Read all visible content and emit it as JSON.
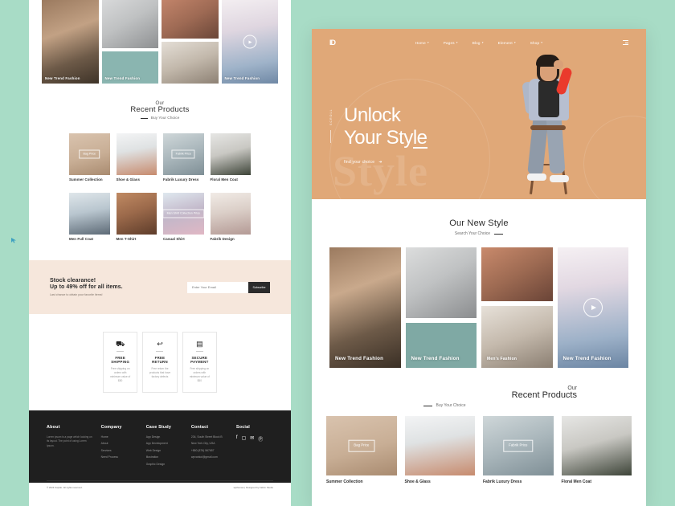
{
  "canvas": {
    "background_color": "#a8dcc6"
  },
  "left_mockup": {
    "hero_tiles": [
      {
        "caption": "New Trend Fashion"
      },
      {
        "caption": ""
      },
      {
        "caption": "New Trend Fashion"
      },
      {
        "caption": ""
      },
      {
        "caption": ""
      },
      {
        "caption": "New Trend Fashion"
      }
    ],
    "recent_products": {
      "eyebrow": "Our",
      "title": "Recent Products",
      "subtitle": "Buy Your Choice"
    },
    "products_row1": [
      {
        "name": "Summer Collection",
        "tag": "Bag Price"
      },
      {
        "name": "Shoe & Glass",
        "tag": ""
      },
      {
        "name": "Fabrik Luxury Dress",
        "tag": "Fabrik Price"
      },
      {
        "name": "Floral Men Coat",
        "tag": ""
      }
    ],
    "products_row2": [
      {
        "name": "Men Full Coat",
        "tag": ""
      },
      {
        "name": "Men T-Shirt",
        "tag": ""
      },
      {
        "name": "Casual Shirt",
        "tag": "Men Shirt Collection Price"
      },
      {
        "name": "Fabrik Design",
        "tag": ""
      }
    ],
    "clearance": {
      "line1": "Stock clearance!",
      "line2": "Up to 49% off for all items.",
      "note": "Last chance to obtain your favorite items!",
      "email_placeholder": "Enter Your Email",
      "subscribe_label": "Subscribe"
    },
    "features": [
      {
        "icon": "truck-icon",
        "glyph": "⛟",
        "title": "FREE SHIPPING",
        "text": "Free shipping on orders with minimum value of $50"
      },
      {
        "icon": "return-arrow-icon",
        "glyph": "↩",
        "title": "FREE RETURN",
        "text": "Free return the products that have factory defects"
      },
      {
        "icon": "card-icon",
        "glyph": "▤",
        "title": "SECURE PAYMENT",
        "text": "Free shipping on orders with minimum value of $50"
      }
    ],
    "footer": {
      "about": {
        "heading": "About",
        "text": "Lorem ipsum is a page which looking on its layout. The point of using Lorem Ipsum."
      },
      "company": {
        "heading": "Company",
        "links": [
          "Home",
          "About",
          "Services",
          "Need Process"
        ]
      },
      "case_study": {
        "heading": "Case Study",
        "links": [
          "App Design",
          "App Development",
          "Web Design",
          "Illustration",
          "Graphic Design"
        ]
      },
      "contact": {
        "heading": "Contact",
        "lines": [
          "234, South Street Block B",
          "New York City, USA",
          "+880 (876) 567657",
          "wpvankol@gmail.com"
        ]
      },
      "social": {
        "heading": "Social",
        "icons": [
          "facebook-icon",
          "instagram-icon",
          "twitter-icon",
          "pinterest-icon"
        ],
        "glyphs": [
          "f",
          "▢",
          "✉",
          "Ⓟ"
        ]
      },
      "copyright": "© 2024 Kapido. All rights reserved.",
      "credit": "wpthemes | Designed by Fahim Studio"
    }
  },
  "right_mockup": {
    "nav": {
      "logo": "ID",
      "items": [
        {
          "label": "Home",
          "has_dropdown": true
        },
        {
          "label": "Pages",
          "has_dropdown": true
        },
        {
          "label": "Blog",
          "has_dropdown": true
        },
        {
          "label": "Element",
          "has_dropdown": true
        },
        {
          "label": "Shop",
          "has_dropdown": true
        }
      ],
      "menu_icon": "hamburger-icon"
    },
    "hero": {
      "background_color": "#e0a878",
      "vertical_label": "SCROLL",
      "ghost_text": "Style",
      "headline_line1": "Unlock",
      "headline_line2": "Your Style",
      "cta_label": "find your choice",
      "cta_icon": "arrow-right-icon"
    },
    "new_style": {
      "title": "Our New Style",
      "subtitle": "Search Your Choice"
    },
    "new_style_tiles": [
      {
        "caption": "New Trend Fashion"
      },
      {
        "caption": ""
      },
      {
        "caption": "New Trend Fashion"
      },
      {
        "caption": "Men's Fashion"
      },
      {
        "caption": ""
      },
      {
        "caption": "New Trend Fashion"
      }
    ],
    "recent_products": {
      "eyebrow": "Our",
      "title": "Recent Products",
      "subtitle": "Buy Your Choice"
    },
    "products": [
      {
        "name": "Summer Collection",
        "tag": "Bag Price"
      },
      {
        "name": "Shoe & Glass",
        "tag": ""
      },
      {
        "name": "Fabrik Luxury Dress",
        "tag": "Fabrik Price"
      },
      {
        "name": "Floral Men Coat",
        "tag": ""
      }
    ]
  }
}
